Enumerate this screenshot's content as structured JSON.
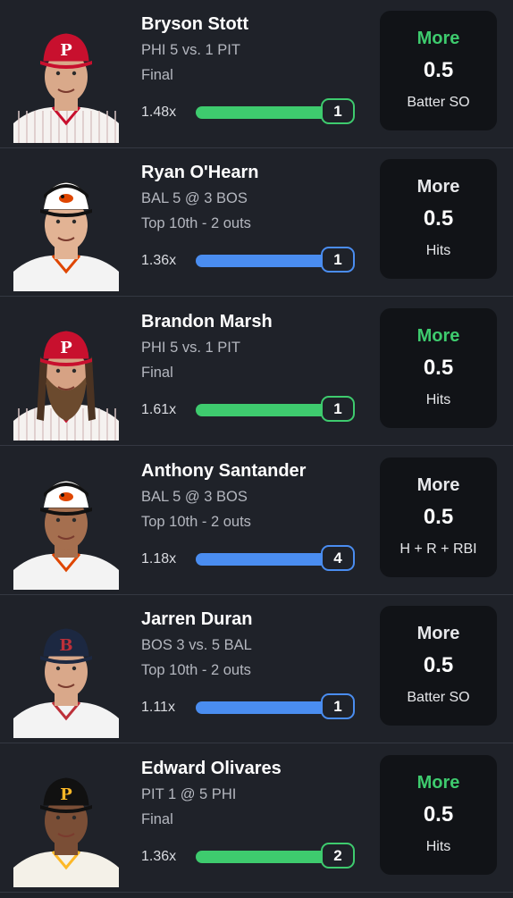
{
  "colors": {
    "background": "#1f2229",
    "card": "#111317",
    "win_green": "#3ecb6e",
    "live_blue": "#4a8df0",
    "pick_live": "#e6e7ea"
  },
  "players": [
    {
      "name": "Bryson Stott",
      "matchup": "PHI 5 vs. 1 PIT",
      "status": "Final",
      "multiplier": "1.48x",
      "count": "1",
      "bar_color": "green",
      "pick_direction": "More",
      "pick_direction_color": "#3ecb6e",
      "pick_line": "0.5",
      "pick_stat": "Batter SO",
      "cap_logo": "P",
      "cap_color": "#c8102e",
      "jersey": "phillies"
    },
    {
      "name": "Ryan O'Hearn",
      "matchup": "BAL 5 @ 3 BOS",
      "status": "Top 10th  -  2 outs",
      "multiplier": "1.36x",
      "count": "1",
      "bar_color": "blue",
      "pick_direction": "More",
      "pick_direction_color": "#e6e7ea",
      "pick_line": "0.5",
      "pick_stat": "Hits",
      "cap_logo": "oriole-bird",
      "cap_color": "#ffffff",
      "jersey": "orioles"
    },
    {
      "name": "Brandon Marsh",
      "matchup": "PHI 5 vs. 1 PIT",
      "status": "Final",
      "multiplier": "1.61x",
      "count": "1",
      "bar_color": "green",
      "pick_direction": "More",
      "pick_direction_color": "#3ecb6e",
      "pick_line": "0.5",
      "pick_stat": "Hits",
      "cap_logo": "P",
      "cap_color": "#c8102e",
      "jersey": "phillies"
    },
    {
      "name": "Anthony Santander",
      "matchup": "BAL 5 @ 3 BOS",
      "status": "Top 10th  -  2 outs",
      "multiplier": "1.18x",
      "count": "4",
      "bar_color": "blue",
      "pick_direction": "More",
      "pick_direction_color": "#e6e7ea",
      "pick_line": "0.5",
      "pick_stat": "H + R + RBI",
      "cap_logo": "oriole-bird",
      "cap_color": "#ffffff",
      "jersey": "orioles"
    },
    {
      "name": "Jarren Duran",
      "matchup": "BOS 3 vs. 5 BAL",
      "status": "Top 10th  -  2 outs",
      "multiplier": "1.11x",
      "count": "1",
      "bar_color": "blue",
      "pick_direction": "More",
      "pick_direction_color": "#e6e7ea",
      "pick_line": "0.5",
      "pick_stat": "Batter SO",
      "cap_logo": "B",
      "cap_color": "#1c2841",
      "jersey": "redsox"
    },
    {
      "name": "Edward Olivares",
      "matchup": "PIT 1 @ 5 PHI",
      "status": "Final",
      "multiplier": "1.36x",
      "count": "2",
      "bar_color": "green",
      "pick_direction": "More",
      "pick_direction_color": "#3ecb6e",
      "pick_line": "0.5",
      "pick_stat": "Hits",
      "cap_logo": "P",
      "cap_color": "#111111",
      "jersey": "pirates"
    }
  ]
}
